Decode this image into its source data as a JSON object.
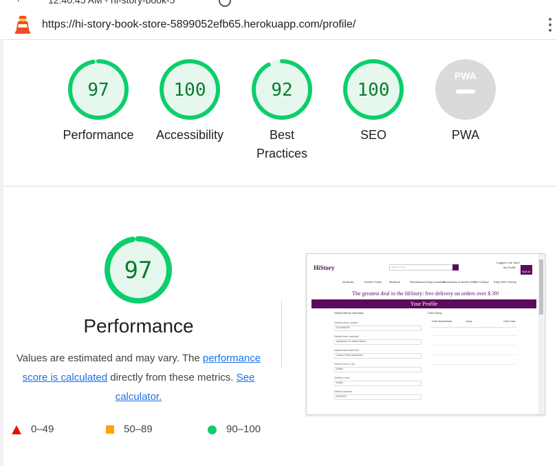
{
  "browser": {
    "tab_title": "12:40:45 AM - hi-story-book-5",
    "url": "https://hi-story-book-store-5899052efb65.herokuapp.com/profile/"
  },
  "colors": {
    "pass": "#0cce6b",
    "pass_text": "#0a7a2c",
    "pass_bg": "#e6f8ee",
    "average": "#ffa400",
    "fail": "#eb0f00",
    "pwa_gray": "#dadada"
  },
  "gauges": [
    {
      "score": "97",
      "label": "Performance",
      "fraction": 0.97
    },
    {
      "score": "100",
      "label": "Accessibility",
      "fraction": 1.0
    },
    {
      "score": "92",
      "label": "Best Practices",
      "fraction": 0.92
    },
    {
      "score": "100",
      "label": "SEO",
      "fraction": 1.0
    },
    {
      "label": "PWA",
      "badge": "PWA"
    }
  ],
  "performance": {
    "score": "97",
    "fraction": 0.97,
    "title": "Performance",
    "desc_start": "Values are estimated and may vary. The ",
    "link_score": "performance score is calculated",
    "desc_mid": " directly from these metrics. ",
    "link_calc": "See calculator."
  },
  "legend": [
    {
      "range": "0–49",
      "icon": "triangle-icon"
    },
    {
      "range": "50–89",
      "icon": "square-icon"
    },
    {
      "range": "90–100",
      "icon": "circle-icon"
    }
  ],
  "screenshot": {
    "logo": "HiStory",
    "search_placeholder": "Search our site",
    "login": "Logged in as Tom1",
    "my_profile": "My Profile",
    "cart": "$43.44",
    "nav": [
      "All Books",
      "Ancient Times",
      "Medieval",
      "Renaissance",
      "Early Industrial",
      "Revolutions & Modern Era",
      "WW Century",
      "Early WW Century"
    ],
    "deal": "The greatest deal in the HiStory: free delivery on orders over $ 39!",
    "bar_title": "Your Profile",
    "left_heading": "Default Delivery Information",
    "right_heading": "Order History",
    "fields": [
      "Default phone number",
      "Default street address1",
      "Default street address2",
      "Default town or city",
      "Default county",
      "Default postcode"
    ],
    "values": [
      "0123456789",
      "Apartment 10 Vilnius Street",
      "Jordan Flower Apartment",
      "Dublin",
      "Dublin",
      "D01F613"
    ],
    "order_cols": [
      "Order Number",
      "Date",
      "Items",
      "Order Total"
    ]
  }
}
